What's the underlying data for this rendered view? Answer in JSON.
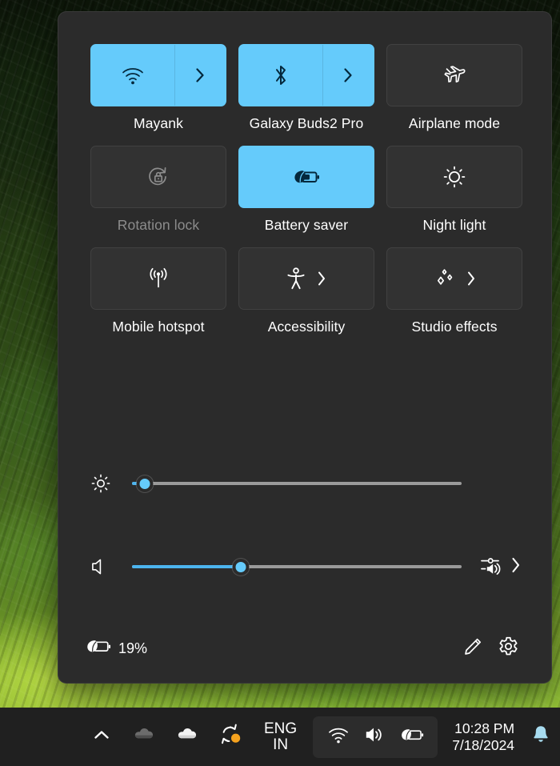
{
  "wallpaper": {
    "description": "tea-plantation-green-foliage"
  },
  "quick_settings": {
    "tiles": [
      {
        "label": "Mayank",
        "icon": "wifi-icon",
        "state": "on",
        "has_chevron": true,
        "name": "wifi"
      },
      {
        "label": "Galaxy Buds2 Pro",
        "icon": "bluetooth-icon",
        "state": "on",
        "has_chevron": true,
        "name": "bluetooth"
      },
      {
        "label": "Airplane mode",
        "icon": "airplane-icon",
        "state": "off",
        "has_chevron": false,
        "name": "airplane-mode"
      },
      {
        "label": "Rotation lock",
        "icon": "rotation-lock-icon",
        "state": "disabled",
        "has_chevron": false,
        "name": "rotation-lock"
      },
      {
        "label": "Battery saver",
        "icon": "battery-saver-icon",
        "state": "on",
        "has_chevron": false,
        "name": "battery-saver"
      },
      {
        "label": "Night light",
        "icon": "night-light-icon",
        "state": "off",
        "has_chevron": false,
        "name": "night-light"
      },
      {
        "label": "Mobile hotspot",
        "icon": "hotspot-icon",
        "state": "off",
        "has_chevron": false,
        "name": "mobile-hotspot"
      },
      {
        "label": "Accessibility",
        "icon": "accessibility-icon",
        "state": "off",
        "has_chevron": true,
        "name": "accessibility"
      },
      {
        "label": "Studio effects",
        "icon": "sparkles-icon",
        "state": "off",
        "has_chevron": true,
        "name": "studio-effects"
      }
    ],
    "sliders": {
      "brightness": {
        "icon": "brightness-icon",
        "value": 4,
        "min": 0,
        "max": 100
      },
      "volume": {
        "icon": "volume-icon",
        "value": 33,
        "min": 0,
        "max": 100,
        "extra_icon": "audio-output-picker-icon"
      }
    },
    "footer": {
      "battery_icon": "battery-saver-icon",
      "battery_percent": "19%",
      "edit_icon": "pencil-icon",
      "settings_icon": "gear-icon"
    }
  },
  "taskbar": {
    "tray_overflow_icon": "chevron-up-icon",
    "tray_items": [
      {
        "name": "onedrive-personal-icon",
        "icon": "cloud-gray-icon"
      },
      {
        "name": "onedrive-work-icon",
        "icon": "cloud-white-icon"
      },
      {
        "name": "sync-status-icon",
        "icon": "sync-warning-icon"
      }
    ],
    "language": {
      "line1": "ENG",
      "line2": "IN"
    },
    "pinned_tray": [
      {
        "name": "network-icon",
        "icon": "wifi-icon"
      },
      {
        "name": "volume-icon",
        "icon": "speaker-icon"
      },
      {
        "name": "battery-icon",
        "icon": "battery-saver-icon"
      }
    ],
    "clock": {
      "time": "10:28 PM",
      "date": "7/18/2024"
    },
    "notifications_icon": "bell-icon"
  },
  "colors": {
    "accent": "#65cbfb",
    "accent_fill": "#4cb4ee",
    "panel_bg": "#2b2b2b",
    "tile_off_bg": "#323232",
    "taskbar_bg": "#202020",
    "text": "#ffffff",
    "text_dim": "#8c8c8c",
    "bell": "#a8dcf0"
  }
}
